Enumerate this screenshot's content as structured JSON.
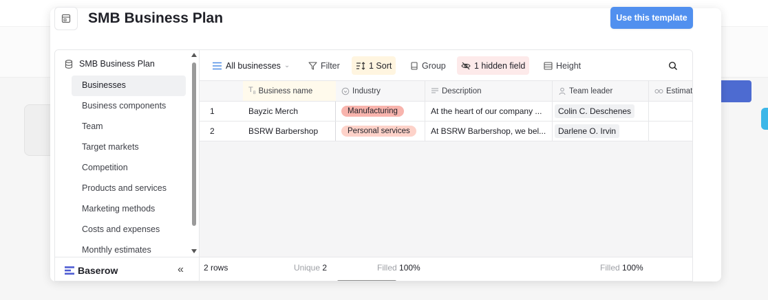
{
  "modal": {
    "title": "SMB Business Plan",
    "cta_label": "Use this template"
  },
  "sidebar": {
    "database_name": "SMB Business Plan",
    "tables": [
      {
        "label": "Businesses",
        "active": true
      },
      {
        "label": "Business components"
      },
      {
        "label": "Team"
      },
      {
        "label": "Target markets"
      },
      {
        "label": "Competition"
      },
      {
        "label": "Products and services"
      },
      {
        "label": "Marketing methods"
      },
      {
        "label": "Costs and expenses"
      },
      {
        "label": "Monthly estimates"
      }
    ],
    "logo_text": "Baserow",
    "collapse_glyph": "«"
  },
  "toolbar": {
    "view_label": "All businesses",
    "filter_label": "Filter",
    "sort_label": "1 Sort",
    "group_label": "Group",
    "hidden_label": "1 hidden field",
    "height_label": "Height"
  },
  "grid": {
    "columns": [
      {
        "name": "Business name",
        "icon": "text-field-icon"
      },
      {
        "name": "Industry",
        "icon": "single-select-icon"
      },
      {
        "name": "Description",
        "icon": "long-text-icon"
      },
      {
        "name": "Team leader",
        "icon": "link-row-icon"
      },
      {
        "name": "Estimat",
        "icon": "lookup-icon"
      }
    ],
    "rows": [
      {
        "id": "1",
        "business_name": "Bayzic Merch",
        "industry": "Manufacturing",
        "industry_color": "#f8b4ad",
        "description": "At the heart of our company ...",
        "team_leader": "Colin C. Deschenes"
      },
      {
        "id": "2",
        "business_name": "BSRW Barbershop",
        "industry": "Personal services",
        "industry_color": "#fdd2c9",
        "description": "At BSRW Barbershop, we bel...",
        "team_leader": "Darlene O. Irvin"
      }
    ]
  },
  "footer": {
    "row_count": "2 rows",
    "unique_label": "Unique",
    "unique_value": "2",
    "filled_label_1": "Filled",
    "filled_value_1": "100%",
    "filled_label_2": "Filled",
    "filled_value_2": "100%"
  },
  "colors": {
    "accent": "#5190ef",
    "logo_blue": "#4e5cd3"
  }
}
